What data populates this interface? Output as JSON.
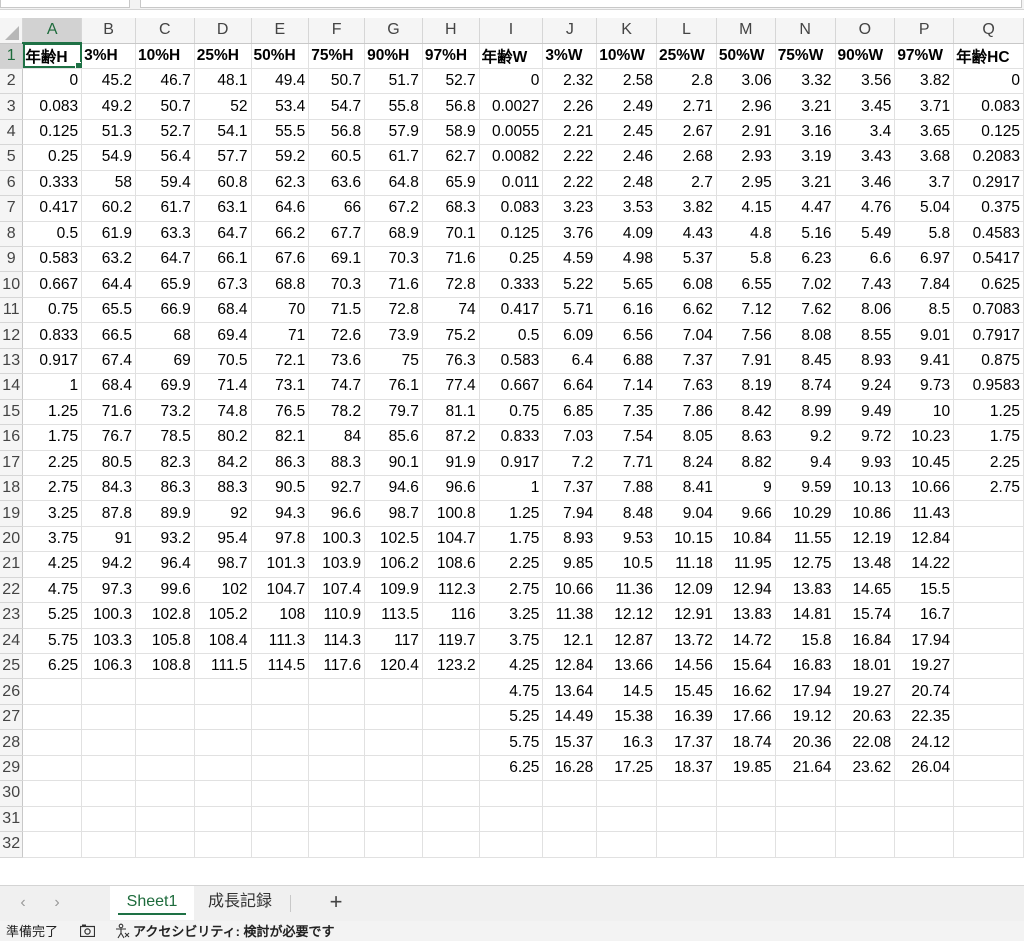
{
  "columns": [
    "A",
    "B",
    "C",
    "D",
    "E",
    "F",
    "G",
    "H",
    "I",
    "J",
    "K",
    "L",
    "M",
    "N",
    "O",
    "P",
    "Q"
  ],
  "active_column": "A",
  "active_row": 1,
  "row_numbers": [
    1,
    2,
    3,
    4,
    5,
    6,
    7,
    8,
    9,
    10,
    11,
    12,
    13,
    14,
    15,
    16,
    17,
    18,
    19,
    20,
    21,
    22,
    23,
    24,
    25,
    26,
    27,
    28,
    29,
    30,
    31,
    32
  ],
  "rows": [
    [
      "年齢H",
      "3%H",
      "10%H",
      "25%H",
      "50%H",
      "75%H",
      "90%H",
      "97%H",
      "年齢W",
      "3%W",
      "10%W",
      "25%W",
      "50%W",
      "75%W",
      "90%W",
      "97%W",
      "年齢HC"
    ],
    [
      "0",
      "45.2",
      "46.7",
      "48.1",
      "49.4",
      "50.7",
      "51.7",
      "52.7",
      "0",
      "2.32",
      "2.58",
      "2.8",
      "3.06",
      "3.32",
      "3.56",
      "3.82",
      "0"
    ],
    [
      "0.083",
      "49.2",
      "50.7",
      "52",
      "53.4",
      "54.7",
      "55.8",
      "56.8",
      "0.0027",
      "2.26",
      "2.49",
      "2.71",
      "2.96",
      "3.21",
      "3.45",
      "3.71",
      "0.083"
    ],
    [
      "0.125",
      "51.3",
      "52.7",
      "54.1",
      "55.5",
      "56.8",
      "57.9",
      "58.9",
      "0.0055",
      "2.21",
      "2.45",
      "2.67",
      "2.91",
      "3.16",
      "3.4",
      "3.65",
      "0.125"
    ],
    [
      "0.25",
      "54.9",
      "56.4",
      "57.7",
      "59.2",
      "60.5",
      "61.7",
      "62.7",
      "0.0082",
      "2.22",
      "2.46",
      "2.68",
      "2.93",
      "3.19",
      "3.43",
      "3.68",
      "0.2083"
    ],
    [
      "0.333",
      "58",
      "59.4",
      "60.8",
      "62.3",
      "63.6",
      "64.8",
      "65.9",
      "0.011",
      "2.22",
      "2.48",
      "2.7",
      "2.95",
      "3.21",
      "3.46",
      "3.7",
      "0.2917"
    ],
    [
      "0.417",
      "60.2",
      "61.7",
      "63.1",
      "64.6",
      "66",
      "67.2",
      "68.3",
      "0.083",
      "3.23",
      "3.53",
      "3.82",
      "4.15",
      "4.47",
      "4.76",
      "5.04",
      "0.375"
    ],
    [
      "0.5",
      "61.9",
      "63.3",
      "64.7",
      "66.2",
      "67.7",
      "68.9",
      "70.1",
      "0.125",
      "3.76",
      "4.09",
      "4.43",
      "4.8",
      "5.16",
      "5.49",
      "5.8",
      "0.4583"
    ],
    [
      "0.583",
      "63.2",
      "64.7",
      "66.1",
      "67.6",
      "69.1",
      "70.3",
      "71.6",
      "0.25",
      "4.59",
      "4.98",
      "5.37",
      "5.8",
      "6.23",
      "6.6",
      "6.97",
      "0.5417"
    ],
    [
      "0.667",
      "64.4",
      "65.9",
      "67.3",
      "68.8",
      "70.3",
      "71.6",
      "72.8",
      "0.333",
      "5.22",
      "5.65",
      "6.08",
      "6.55",
      "7.02",
      "7.43",
      "7.84",
      "0.625"
    ],
    [
      "0.75",
      "65.5",
      "66.9",
      "68.4",
      "70",
      "71.5",
      "72.8",
      "74",
      "0.417",
      "5.71",
      "6.16",
      "6.62",
      "7.12",
      "7.62",
      "8.06",
      "8.5",
      "0.7083"
    ],
    [
      "0.833",
      "66.5",
      "68",
      "69.4",
      "71",
      "72.6",
      "73.9",
      "75.2",
      "0.5",
      "6.09",
      "6.56",
      "7.04",
      "7.56",
      "8.08",
      "8.55",
      "9.01",
      "0.7917"
    ],
    [
      "0.917",
      "67.4",
      "69",
      "70.5",
      "72.1",
      "73.6",
      "75",
      "76.3",
      "0.583",
      "6.4",
      "6.88",
      "7.37",
      "7.91",
      "8.45",
      "8.93",
      "9.41",
      "0.875"
    ],
    [
      "1",
      "68.4",
      "69.9",
      "71.4",
      "73.1",
      "74.7",
      "76.1",
      "77.4",
      "0.667",
      "6.64",
      "7.14",
      "7.63",
      "8.19",
      "8.74",
      "9.24",
      "9.73",
      "0.9583"
    ],
    [
      "1.25",
      "71.6",
      "73.2",
      "74.8",
      "76.5",
      "78.2",
      "79.7",
      "81.1",
      "0.75",
      "6.85",
      "7.35",
      "7.86",
      "8.42",
      "8.99",
      "9.49",
      "10",
      "1.25"
    ],
    [
      "1.75",
      "76.7",
      "78.5",
      "80.2",
      "82.1",
      "84",
      "85.6",
      "87.2",
      "0.833",
      "7.03",
      "7.54",
      "8.05",
      "8.63",
      "9.2",
      "9.72",
      "10.23",
      "1.75"
    ],
    [
      "2.25",
      "80.5",
      "82.3",
      "84.2",
      "86.3",
      "88.3",
      "90.1",
      "91.9",
      "0.917",
      "7.2",
      "7.71",
      "8.24",
      "8.82",
      "9.4",
      "9.93",
      "10.45",
      "2.25"
    ],
    [
      "2.75",
      "84.3",
      "86.3",
      "88.3",
      "90.5",
      "92.7",
      "94.6",
      "96.6",
      "1",
      "7.37",
      "7.88",
      "8.41",
      "9",
      "9.59",
      "10.13",
      "10.66",
      "2.75"
    ],
    [
      "3.25",
      "87.8",
      "89.9",
      "92",
      "94.3",
      "96.6",
      "98.7",
      "100.8",
      "1.25",
      "7.94",
      "8.48",
      "9.04",
      "9.66",
      "10.29",
      "10.86",
      "11.43",
      ""
    ],
    [
      "3.75",
      "91",
      "93.2",
      "95.4",
      "97.8",
      "100.3",
      "102.5",
      "104.7",
      "1.75",
      "8.93",
      "9.53",
      "10.15",
      "10.84",
      "11.55",
      "12.19",
      "12.84",
      ""
    ],
    [
      "4.25",
      "94.2",
      "96.4",
      "98.7",
      "101.3",
      "103.9",
      "106.2",
      "108.6",
      "2.25",
      "9.85",
      "10.5",
      "11.18",
      "11.95",
      "12.75",
      "13.48",
      "14.22",
      ""
    ],
    [
      "4.75",
      "97.3",
      "99.6",
      "102",
      "104.7",
      "107.4",
      "109.9",
      "112.3",
      "2.75",
      "10.66",
      "11.36",
      "12.09",
      "12.94",
      "13.83",
      "14.65",
      "15.5",
      ""
    ],
    [
      "5.25",
      "100.3",
      "102.8",
      "105.2",
      "108",
      "110.9",
      "113.5",
      "116",
      "3.25",
      "11.38",
      "12.12",
      "12.91",
      "13.83",
      "14.81",
      "15.74",
      "16.7",
      ""
    ],
    [
      "5.75",
      "103.3",
      "105.8",
      "108.4",
      "111.3",
      "114.3",
      "117",
      "119.7",
      "3.75",
      "12.1",
      "12.87",
      "13.72",
      "14.72",
      "15.8",
      "16.84",
      "17.94",
      ""
    ],
    [
      "6.25",
      "106.3",
      "108.8",
      "111.5",
      "114.5",
      "117.6",
      "120.4",
      "123.2",
      "4.25",
      "12.84",
      "13.66",
      "14.56",
      "15.64",
      "16.83",
      "18.01",
      "19.27",
      ""
    ],
    [
      "",
      "",
      "",
      "",
      "",
      "",
      "",
      "",
      "4.75",
      "13.64",
      "14.5",
      "15.45",
      "16.62",
      "17.94",
      "19.27",
      "20.74",
      ""
    ],
    [
      "",
      "",
      "",
      "",
      "",
      "",
      "",
      "",
      "5.25",
      "14.49",
      "15.38",
      "16.39",
      "17.66",
      "19.12",
      "20.63",
      "22.35",
      ""
    ],
    [
      "",
      "",
      "",
      "",
      "",
      "",
      "",
      "",
      "5.75",
      "15.37",
      "16.3",
      "17.37",
      "18.74",
      "20.36",
      "22.08",
      "24.12",
      ""
    ],
    [
      "",
      "",
      "",
      "",
      "",
      "",
      "",
      "",
      "6.25",
      "16.28",
      "17.25",
      "18.37",
      "19.85",
      "21.64",
      "23.62",
      "26.04",
      ""
    ],
    [
      "",
      "",
      "",
      "",
      "",
      "",
      "",
      "",
      "",
      "",
      "",
      "",
      "",
      "",
      "",
      "",
      ""
    ],
    [
      "",
      "",
      "",
      "",
      "",
      "",
      "",
      "",
      "",
      "",
      "",
      "",
      "",
      "",
      "",
      "",
      ""
    ],
    [
      "",
      "",
      "",
      "",
      "",
      "",
      "",
      "",
      "",
      "",
      "",
      "",
      "",
      "",
      "",
      "",
      ""
    ]
  ],
  "sheet_tabs": [
    {
      "label": "Sheet1",
      "active": true
    },
    {
      "label": "成長記録",
      "active": false
    }
  ],
  "tab_nav": {
    "prev_icon": "‹",
    "next_icon": "›",
    "add_icon": "+"
  },
  "status": {
    "mode": "準備完了",
    "accessibility": "アクセシビリティ: 検討が必要です"
  },
  "colors": {
    "accent": "#1e7145",
    "header_bg": "#f5f5f5",
    "grid_line": "#e1e1e1"
  }
}
